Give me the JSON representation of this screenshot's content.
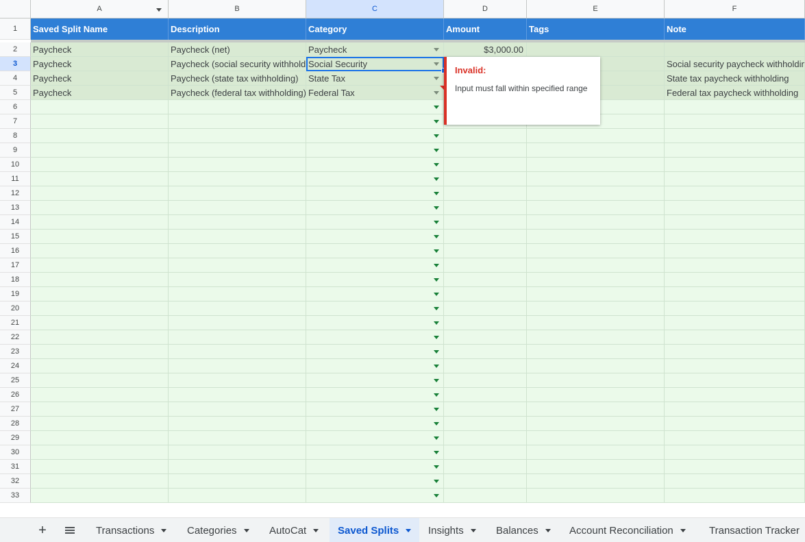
{
  "columns": [
    "A",
    "B",
    "C",
    "D",
    "E",
    "F"
  ],
  "header_row": {
    "row_number": "1",
    "cells": [
      "Saved Split Name",
      "Description",
      "Category",
      "Amount",
      "Tags",
      "Note"
    ]
  },
  "data_rows": [
    {
      "row_number": "2",
      "name": "Paycheck",
      "description": "Paycheck (net)",
      "category": "Paycheck",
      "amount": "$3,000.00",
      "tags": "",
      "note": ""
    },
    {
      "row_number": "3",
      "name": "Paycheck",
      "description": "Paycheck (social security withholding)",
      "category": "Social Security",
      "amount": "",
      "tags": "",
      "note": "Social security paycheck withholding"
    },
    {
      "row_number": "4",
      "name": "Paycheck",
      "description": "Paycheck (state tax withholding)",
      "category": "State Tax",
      "amount": "",
      "tags": "",
      "note": "State tax paycheck withholding"
    },
    {
      "row_number": "5",
      "name": "Paycheck",
      "description": "Paycheck (federal tax withholding)",
      "category": "Federal Tax",
      "amount": "",
      "tags": "",
      "note": "Federal tax paycheck withholding"
    }
  ],
  "empty_row_numbers": [
    "6",
    "7",
    "8",
    "9",
    "10",
    "11",
    "12",
    "13",
    "14",
    "15",
    "16",
    "17",
    "18",
    "19",
    "20",
    "21",
    "22",
    "23",
    "24",
    "25",
    "26",
    "27",
    "28",
    "29",
    "30",
    "31",
    "32",
    "33"
  ],
  "validation_tooltip": {
    "title": "Invalid:",
    "message": "Input must fall within specified range"
  },
  "sheet_tabs": [
    "Transactions",
    "Categories",
    "AutoCat",
    "Saved Splits",
    "Insights",
    "Balances",
    "Account Reconciliation",
    "Transaction Tracker"
  ],
  "active_tab": "Saved Splits",
  "colors": {
    "header_fill": "#2f7fd6",
    "data_row_fill": "#d9ead3",
    "empty_row_fill": "#ebfaea",
    "error_red": "#d93025",
    "selection_blue": "#1a73e8"
  }
}
